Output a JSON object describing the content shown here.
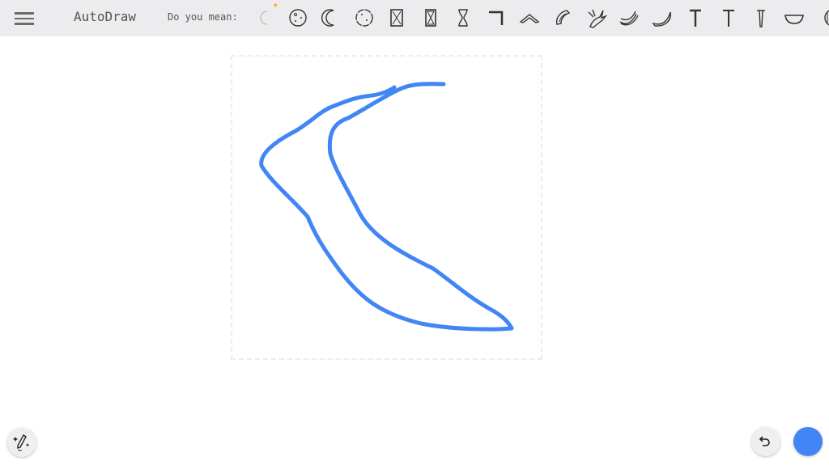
{
  "app": {
    "title": "AutoDraw"
  },
  "toolbar": {
    "prompt": "Do you mean:",
    "suggestions": [
      "moon-faded",
      "moon-face",
      "crescent-moon",
      "full-moon",
      "hourglass",
      "hourglass-2",
      "hourglass-3",
      "corner-bracket",
      "boomerang",
      "boomerang-2",
      "banana-peeled",
      "banana-bunch",
      "banana",
      "nail",
      "nail-2",
      "screw",
      "bowl",
      "striped-ball"
    ]
  },
  "colors": {
    "stroke": "#4285f4",
    "accent": "#4285f4",
    "toolbar_bg": "#ececee"
  }
}
